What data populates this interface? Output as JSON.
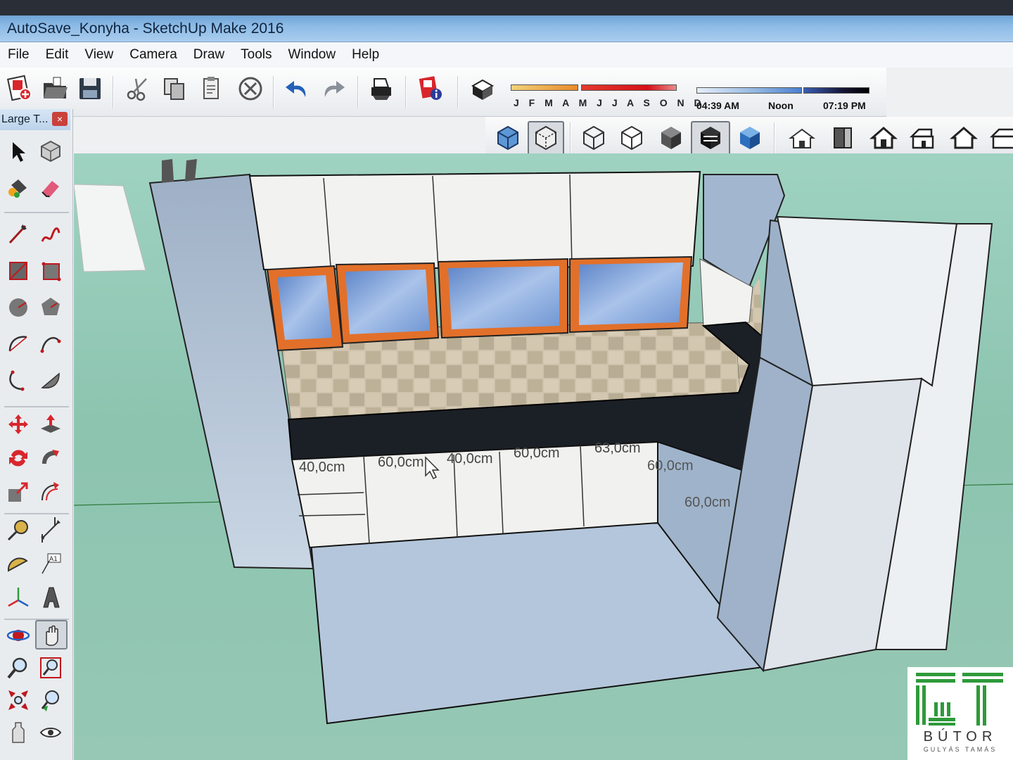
{
  "window": {
    "title": "AutoSave_Konyha - SketchUp Make 2016"
  },
  "menu": [
    "File",
    "Edit",
    "View",
    "Camera",
    "Draw",
    "Tools",
    "Window",
    "Help"
  ],
  "toolbar": {
    "icons": [
      "new-icon",
      "open-icon",
      "save-icon",
      "cut-icon",
      "copy-icon",
      "paste-icon",
      "erase-icon",
      "undo-icon",
      "redo-icon",
      "print-icon",
      "model-info-icon"
    ]
  },
  "shadows": {
    "months": "J F M A M J J A S O N D",
    "time_start": "04:39 AM",
    "time_mid": "Noon",
    "time_end": "07:19 PM"
  },
  "palette": {
    "title": "Large T...",
    "close": "×"
  },
  "dimensions": {
    "d1": "40,0cm",
    "d2": "60,0cm",
    "d3": "40,0cm",
    "d4": "60,0cm",
    "d5": "63,0cm",
    "d6": "60,0cm",
    "d7": "60,0cm"
  },
  "colors": {
    "accent_orange": "#e2702a",
    "sky_glass": "#7fa6dc",
    "countertop": "#1b1f26",
    "ground": "#8cc4b0"
  },
  "logo": {
    "word": "BÚTOR",
    "sub": "GULYÁS TAMÁS"
  }
}
